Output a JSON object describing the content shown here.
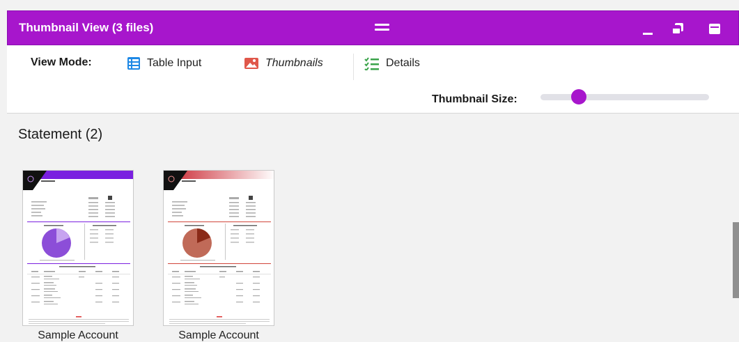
{
  "window": {
    "title": "Thumbnail View (3 files)",
    "accent_color": "#a716cc"
  },
  "toolbar": {
    "view_mode_label": "View Mode:",
    "options": [
      {
        "label": "Table Input",
        "icon": "table-icon"
      },
      {
        "label": "Thumbnails",
        "icon": "image-icon"
      },
      {
        "label": "Details",
        "icon": "checklist-icon"
      }
    ],
    "thumbnail_size_label": "Thumbnail Size:",
    "thumbnail_size_level": 0.2
  },
  "groups": [
    {
      "title": "Statement (2)",
      "items": [
        {
          "name": "Sample Account",
          "accent": "#7a1fe0"
        },
        {
          "name": "Sample Account",
          "accent": "#d0453a"
        }
      ]
    }
  ]
}
